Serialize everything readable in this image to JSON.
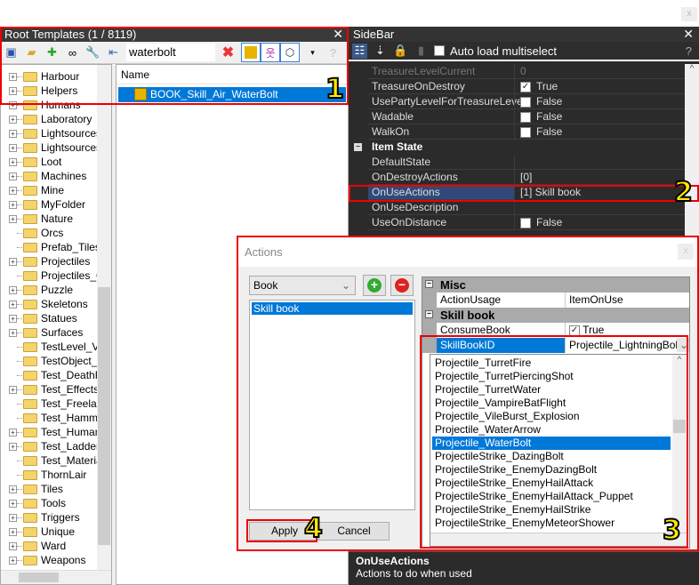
{
  "top_close": "x",
  "root_templates": {
    "title": "Root Templates (1 / 8119)",
    "close": "✕",
    "toolbar_icons": [
      "save-icon",
      "open-folder-icon",
      "add-objects-icon",
      "binoculars-icon",
      "wrench-icon",
      "collapse-icon"
    ],
    "search_value": "waterbolt",
    "help": "?",
    "tree": [
      {
        "label": "Harbour",
        "expand": true
      },
      {
        "label": "Helpers",
        "expand": true
      },
      {
        "label": "Humans",
        "expand": true
      },
      {
        "label": "Laboratory",
        "expand": true
      },
      {
        "label": "Lightsources",
        "expand": true
      },
      {
        "label": "Lightsources_",
        "expand": true
      },
      {
        "label": "Loot",
        "expand": true
      },
      {
        "label": "Machines",
        "expand": true
      },
      {
        "label": "Mine",
        "expand": true
      },
      {
        "label": "MyFolder",
        "expand": true
      },
      {
        "label": "Nature",
        "expand": true
      },
      {
        "label": "Orcs",
        "expand": false
      },
      {
        "label": "Prefab_Tiles",
        "expand": false
      },
      {
        "label": "Projectiles",
        "expand": true
      },
      {
        "label": "Projectiles_O",
        "expand": false
      },
      {
        "label": "Puzzle",
        "expand": true
      },
      {
        "label": "Skeletons",
        "expand": true
      },
      {
        "label": "Statues",
        "expand": true
      },
      {
        "label": "Surfaces",
        "expand": true
      },
      {
        "label": "TestLevel_Vi",
        "expand": false
      },
      {
        "label": "TestObject_M",
        "expand": false
      },
      {
        "label": "Test_DeathF",
        "expand": false
      },
      {
        "label": "Test_Effects",
        "expand": true
      },
      {
        "label": "Test_Freelan",
        "expand": false
      },
      {
        "label": "Test_Hamme",
        "expand": false
      },
      {
        "label": "Test_Humans",
        "expand": true
      },
      {
        "label": "Test_Ladder",
        "expand": true
      },
      {
        "label": "Test_Materia",
        "expand": false
      },
      {
        "label": "ThornLair",
        "expand": false
      },
      {
        "label": "Tiles",
        "expand": true
      },
      {
        "label": "Tools",
        "expand": true
      },
      {
        "label": "Triggers",
        "expand": true
      },
      {
        "label": "Unique",
        "expand": true
      },
      {
        "label": "Ward",
        "expand": true
      },
      {
        "label": "Weapons",
        "expand": true
      }
    ],
    "list_header": "Name",
    "selected_item": "BOOK_Skill_Air_WaterBolt"
  },
  "sidebar": {
    "title": "SideBar",
    "close": "✕",
    "auto_load": "Auto load multiselect",
    "help": "?",
    "rows": [
      {
        "name": "TreasureLevelCurrent",
        "value": "0",
        "dim": true
      },
      {
        "name": "TreasureOnDestroy",
        "value": "True",
        "check": true
      },
      {
        "name": "UsePartyLevelForTreasureLevel",
        "value": "False",
        "check": false
      },
      {
        "name": "Wadable",
        "value": "False",
        "check": false
      },
      {
        "name": "WalkOn",
        "value": "False",
        "check": false
      },
      {
        "category": "Item State"
      },
      {
        "name": "DefaultState",
        "value": ""
      },
      {
        "name": "OnDestroyActions",
        "value": "[0]"
      },
      {
        "name": "OnUseActions",
        "value": "[1] Skill book",
        "selected": true
      },
      {
        "name": "OnUseDescription",
        "value": ""
      },
      {
        "name": "UseOnDistance",
        "value": "False",
        "check": false
      }
    ],
    "description_title": "OnUseActions",
    "description_text": "Actions to do when used"
  },
  "actions_dialog": {
    "title": "Actions",
    "close": "x",
    "type_select": "Book",
    "actions_list": [
      "Skill book"
    ],
    "apply": "Apply",
    "cancel": "Cancel",
    "grid": {
      "misc": "Misc",
      "action_usage_label": "ActionUsage",
      "action_usage_value": "ItemOnUse",
      "skill_book": "Skill book",
      "consume_label": "ConsumeBook",
      "consume_value": "True",
      "skillbookid_label": "SkillBookID",
      "skillbookid_value": "Projectile_LightningBolt"
    },
    "dropdown_options": [
      "Projectile_TurretFire",
      "Projectile_TurretPiercingShot",
      "Projectile_TurretWater",
      "Projectile_VampireBatFlight",
      "Projectile_VileBurst_Explosion",
      "Projectile_WaterArrow",
      "Projectile_WaterBolt",
      "ProjectileStrike_DazingBolt",
      "ProjectileStrike_EnemyDazingBolt",
      "ProjectileStrike_EnemyHailAttack",
      "ProjectileStrike_EnemyHailAttack_Puppet",
      "ProjectileStrike_EnemyHailStrike",
      "ProjectileStrike_EnemyMeteorShower"
    ],
    "dropdown_selected": "Projectile_WaterBolt"
  },
  "annotations": [
    "1",
    "2",
    "3",
    "4"
  ],
  "colors": {
    "annotation": "#ee0000",
    "selection": "#0078d7",
    "dark_panel": "#2b2b2b"
  }
}
